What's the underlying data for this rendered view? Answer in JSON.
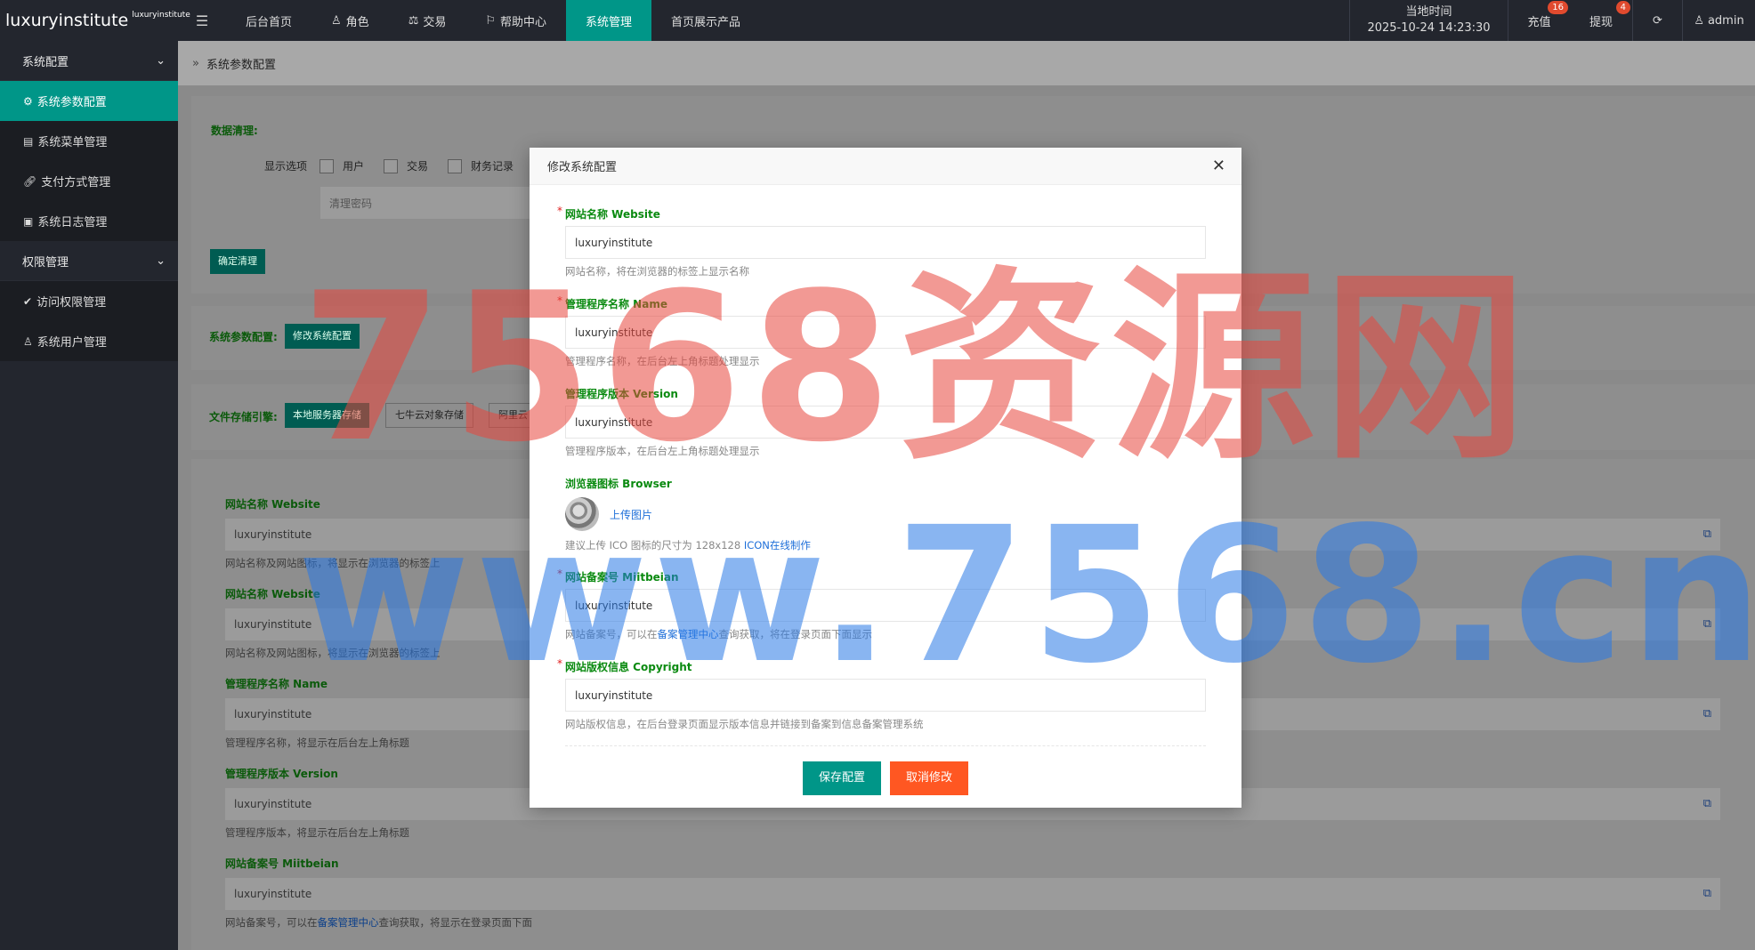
{
  "topbar": {
    "logo": "luxuryinstitute",
    "logo_sup": "luxuryinstitute",
    "nav": [
      {
        "label": "后台首页",
        "icon": ""
      },
      {
        "label": "角色",
        "icon": "user-icon"
      },
      {
        "label": "交易",
        "icon": "scale-icon"
      },
      {
        "label": "帮助中心",
        "icon": "flag-icon"
      },
      {
        "label": "系统管理",
        "icon": ""
      },
      {
        "label": "首页展示产品",
        "icon": ""
      }
    ],
    "time_label": "当地时间",
    "time_value": "2025-10-24 14:23:30",
    "recharge": "充值",
    "recharge_badge": "16",
    "withdraw": "提现",
    "withdraw_badge": "4",
    "user": "admin"
  },
  "sidebar": {
    "groups": [
      {
        "label": "系统配置",
        "items": [
          "系统参数配置",
          "系统菜单管理",
          "支付方式管理",
          "系统日志管理"
        ]
      },
      {
        "label": "权限管理",
        "items": [
          "访问权限管理",
          "系统用户管理"
        ]
      }
    ]
  },
  "main": {
    "breadcrumb": "系统参数配置",
    "cleanup": {
      "title": "数据清理:",
      "options_label": "显示选项",
      "options": [
        "用户",
        "交易",
        "财务记录"
      ],
      "password_placeholder": "清理密码",
      "confirm": "确定清理"
    },
    "sysparam": {
      "label": "系统参数配置:",
      "button": "修改系统配置"
    },
    "storage": {
      "label": "文件存储引擎:",
      "options": [
        "本地服务器存储",
        "七牛云对象存储",
        "阿里云"
      ]
    },
    "fields": [
      {
        "label": "网站名称 Website",
        "value": "luxuryinstitute",
        "hint": "网站名称及网站图标，将显示在浏览器的标签上"
      },
      {
        "label": "网站名称 Website",
        "value": "luxuryinstitute",
        "hint": "网站名称及网站图标，将显示在浏览器的标签上"
      },
      {
        "label": "管理程序名称 Name",
        "value": "luxuryinstitute",
        "hint": "管理程序名称，将显示在后台左上角标题"
      },
      {
        "label": "管理程序版本 Version",
        "value": "luxuryinstitute",
        "hint": "管理程序版本，将显示在后台左上角标题"
      },
      {
        "label": "网站备案号 Miitbeian",
        "value": "luxuryinstitute",
        "hint_pre": "网站备案号，可以在",
        "hint_link": "备案管理中心",
        "hint_post": "查询获取，将显示在登录页面下面"
      }
    ]
  },
  "modal": {
    "title": "修改系统配置",
    "fields": [
      {
        "label": "网站名称 Website",
        "value": "luxuryinstitute",
        "hint": "网站名称，将在浏览器的标签上显示名称"
      },
      {
        "label": "管理程序名称 Name",
        "value": "luxuryinstitute",
        "hint": "管理程序名称，在后台左上角标题处理显示"
      },
      {
        "label": "管理程序版本 Version",
        "value": "luxuryinstitute",
        "hint": "管理程序版本，在后台左上角标题处理显示"
      }
    ],
    "browser": {
      "label": "浏览器图标 Browser",
      "upload": "上传图片",
      "hint_pre": "建议上传 ICO 图标的尺寸为 128x128 ",
      "hint_link": "ICON在线制作"
    },
    "miitbeian": {
      "label": "网站备案号 Miitbeian",
      "value": "luxuryinstitute",
      "hint_pre": "网站备案号，可以在",
      "hint_link": "备案管理中心",
      "hint_post": "查询获取，将在登录页面下面显示"
    },
    "copyright": {
      "label": "网站版权信息 Copyright",
      "value": "luxuryinstitute",
      "hint": "网站版权信息，在后台登录页面显示版本信息并链接到备案到信息备案管理系统"
    },
    "save": "保存配置",
    "cancel": "取消修改"
  },
  "watermark": {
    "line1": "7568资源网",
    "line2": "www.7568.cn"
  }
}
